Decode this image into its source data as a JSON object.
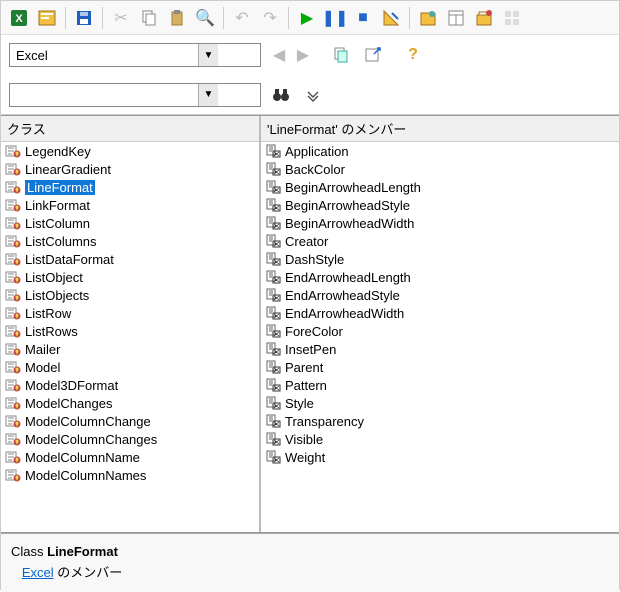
{
  "row2": {
    "library_value": "Excel"
  },
  "row3": {
    "search_value": ""
  },
  "panes": {
    "left_header": "クラス",
    "right_header": "'LineFormat' のメンバー"
  },
  "classes": [
    "LegendKey",
    "LinearGradient",
    "LineFormat",
    "LinkFormat",
    "ListColumn",
    "ListColumns",
    "ListDataFormat",
    "ListObject",
    "ListObjects",
    "ListRow",
    "ListRows",
    "Mailer",
    "Model",
    "Model3DFormat",
    "ModelChanges",
    "ModelColumnChange",
    "ModelColumnChanges",
    "ModelColumnName",
    "ModelColumnNames"
  ],
  "selected_class": "LineFormat",
  "members": [
    "Application",
    "BackColor",
    "BeginArrowheadLength",
    "BeginArrowheadStyle",
    "BeginArrowheadWidth",
    "Creator",
    "DashStyle",
    "EndArrowheadLength",
    "EndArrowheadStyle",
    "EndArrowheadWidth",
    "ForeColor",
    "InsetPen",
    "Parent",
    "Pattern",
    "Style",
    "Transparency",
    "Visible",
    "Weight"
  ],
  "footer": {
    "prefix": "Class ",
    "classname": "LineFormat",
    "link": "Excel",
    "suffix": " のメンバー"
  }
}
